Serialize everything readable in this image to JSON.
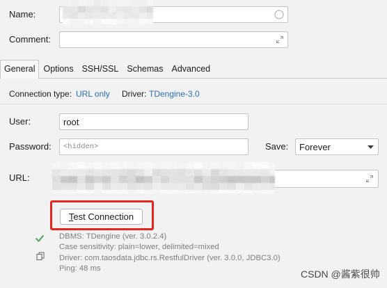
{
  "theme": {
    "background": "#f2f2f2",
    "link_color": "#2a6fb8",
    "highlight_color": "#e4261f",
    "success_color": "#59a869",
    "muted_text_color": "#7e7e7e"
  },
  "general": {
    "name": {
      "label": "Name:",
      "icon": "circle-icon"
    },
    "comment": {
      "label": "Comment:",
      "icon": "expand-icon"
    }
  },
  "tabs": [
    {
      "label": "General",
      "selected": true
    },
    {
      "label": "Options",
      "selected": false
    },
    {
      "label": "SSH/SSL",
      "selected": false
    },
    {
      "label": "Schemas",
      "selected": false
    },
    {
      "label": "Advanced",
      "selected": false
    }
  ],
  "connection": {
    "type_label": "Connection type:",
    "type_value": "URL only",
    "driver_label": "Driver:",
    "driver_value": "TDengine-3.0"
  },
  "user": {
    "label": "User:",
    "value": "root"
  },
  "password": {
    "label": "Password:",
    "placeholder": "<hidden>"
  },
  "save": {
    "label": "Save:",
    "selected": "Forever",
    "icon": "dropdown-arrow-icon"
  },
  "url": {
    "label": "URL:",
    "icon": "expand-icon"
  },
  "test_connection": {
    "label": "Test Connection"
  },
  "result": {
    "status_icon": "check-icon",
    "copy_icon": "copy-icon",
    "lines": [
      "DBMS: TDengine (ver. 3.0.2.4)",
      "Case sensitivity: plain=lower, delimited=mixed",
      "Driver: com.taosdata.jdbc.rs.RestfulDriver (ver. 3.0.0, JDBC3.0)",
      "Ping: 48 ms"
    ]
  },
  "watermark": "CSDN @酱紫很帅"
}
